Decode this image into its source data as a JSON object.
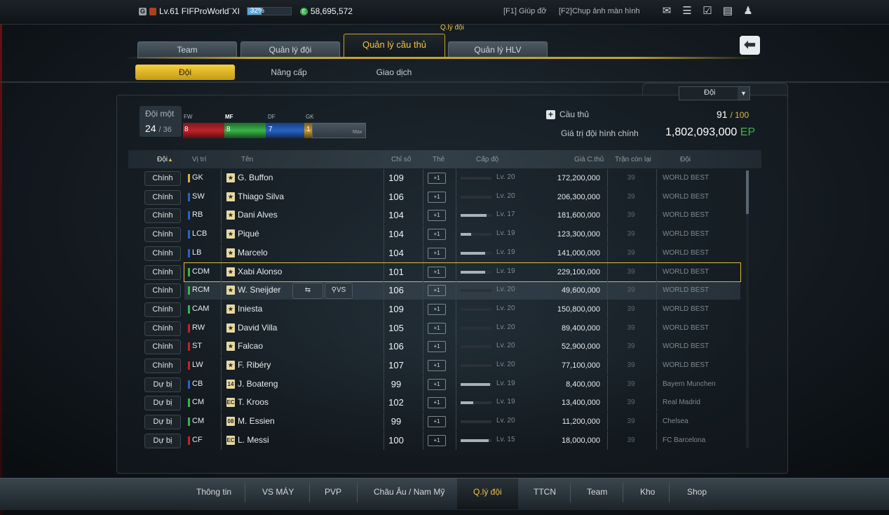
{
  "topbar": {
    "guild_badge": "G",
    "level_text": "Lv.61 FIFProWorld¨XI",
    "exp_percent": 32,
    "exp_label": "32%",
    "coins": "58,695,572",
    "help": "[F1] Giúp đỡ",
    "screenshot": "[F2]Chụp ảnh màn hình",
    "icons": [
      "mail-icon",
      "list-icon",
      "calendar-check-icon",
      "chat-icon",
      "user-icon"
    ]
  },
  "page_hint": "Q.lý đội",
  "main_tabs": [
    {
      "label": "Team"
    },
    {
      "label": "Quản lý đội"
    },
    {
      "label": "Quản lý cầu thủ",
      "active": true
    },
    {
      "label": "Quản lý HLV"
    }
  ],
  "sub_tabs": [
    {
      "label": "Đội",
      "active": true
    },
    {
      "label": "Nâng cấp"
    },
    {
      "label": "Giao dịch"
    }
  ],
  "filter": {
    "selected": "Đội"
  },
  "team_summary": {
    "title": "Đội một",
    "current": "24",
    "max": "/ 36",
    "positions": [
      {
        "label": "FW",
        "count": "8",
        "color": "#c2222a"
      },
      {
        "label": "MF",
        "count": "8",
        "color": "#3cb34a"
      },
      {
        "label": "DF",
        "count": "7",
        "color": "#2a63c4"
      },
      {
        "label": "GK",
        "count": "1",
        "color": "#c99a2c"
      }
    ],
    "max_label": "Max"
  },
  "players_info": {
    "label": "Cầu thủ",
    "count": "91",
    "limit": "/ 100",
    "value_label": "Giá trị đội hình chính",
    "value": "1,802,093,000",
    "value_unit": "EP"
  },
  "table": {
    "headers": {
      "team_status": "Đội",
      "position": "Vị trí",
      "name": "Tên",
      "ovr": "Chỉ số",
      "card": "Thẻ",
      "level": "Cấp độ",
      "price": "Giá C.thủ",
      "games": "Trận còn lại",
      "club": "Đội"
    },
    "rows": [
      {
        "status": "Chính",
        "pos": "GK",
        "pos_color": "#d9b23a",
        "card": "★",
        "name": "G. Buffon",
        "ovr": "109",
        "lvl": "Lv. 20",
        "lvl_frac": 0.0,
        "price": "172,200,000",
        "games": "39",
        "club": "WORLD BEST"
      },
      {
        "status": "Chính",
        "pos": "SW",
        "pos_color": "#2a63c4",
        "card": "★",
        "name": "Thiago Silva",
        "ovr": "106",
        "lvl": "Lv. 20",
        "lvl_frac": 0.0,
        "price": "206,300,000",
        "games": "39",
        "club": "WORLD BEST"
      },
      {
        "status": "Chính",
        "pos": "RB",
        "pos_color": "#2a63c4",
        "card": "★",
        "name": "Dani Alves",
        "ovr": "104",
        "lvl": "Lv. 17",
        "lvl_frac": 0.85,
        "price": "181,600,000",
        "games": "39",
        "club": "WORLD BEST"
      },
      {
        "status": "Chính",
        "pos": "LCB",
        "pos_color": "#2a63c4",
        "card": "★",
        "name": "Piqué",
        "ovr": "104",
        "lvl": "Lv. 19",
        "lvl_frac": 0.35,
        "price": "123,300,000",
        "games": "39",
        "club": "WORLD BEST"
      },
      {
        "status": "Chính",
        "pos": "LB",
        "pos_color": "#2a63c4",
        "card": "★",
        "name": "Marcelo",
        "ovr": "104",
        "lvl": "Lv. 19",
        "lvl_frac": 0.8,
        "price": "141,000,000",
        "games": "39",
        "club": "WORLD BEST"
      },
      {
        "status": "Chính",
        "pos": "CDM",
        "pos_color": "#3cb34a",
        "card": "★",
        "name": "Xabi Alonso",
        "ovr": "101",
        "lvl": "Lv. 19",
        "lvl_frac": 0.8,
        "price": "229,100,000",
        "games": "39",
        "club": "WORLD BEST",
        "selected": true
      },
      {
        "status": "Chính",
        "pos": "RCM",
        "pos_color": "#3cb34a",
        "card": "★",
        "name": "W. Sneijder",
        "ovr": "106",
        "lvl": "Lv. 20",
        "lvl_frac": 0.0,
        "price": "49,600,000",
        "games": "39",
        "club": "WORLD BEST",
        "hover": true
      },
      {
        "status": "Chính",
        "pos": "CAM",
        "pos_color": "#3cb34a",
        "card": "★",
        "name": "Iniesta",
        "ovr": "109",
        "lvl": "Lv. 20",
        "lvl_frac": 0.0,
        "price": "150,800,000",
        "games": "39",
        "club": "WORLD BEST"
      },
      {
        "status": "Chính",
        "pos": "RW",
        "pos_color": "#c2222a",
        "card": "★",
        "name": "David Villa",
        "ovr": "105",
        "lvl": "Lv. 20",
        "lvl_frac": 0.0,
        "price": "89,400,000",
        "games": "39",
        "club": "WORLD BEST"
      },
      {
        "status": "Chính",
        "pos": "ST",
        "pos_color": "#c2222a",
        "card": "★",
        "name": "Falcao",
        "ovr": "106",
        "lvl": "Lv. 20",
        "lvl_frac": 0.0,
        "price": "52,900,000",
        "games": "39",
        "club": "WORLD BEST"
      },
      {
        "status": "Chính",
        "pos": "LW",
        "pos_color": "#c2222a",
        "card": "★",
        "name": "F. Ribéry",
        "ovr": "107",
        "lvl": "Lv. 20",
        "lvl_frac": 0.0,
        "price": "77,100,000",
        "games": "39",
        "club": "WORLD BEST"
      },
      {
        "status": "Dự bị",
        "pos": "CB",
        "pos_color": "#2a63c4",
        "card": "14",
        "name": "J. Boateng",
        "ovr": "99",
        "lvl": "Lv. 19",
        "lvl_frac": 0.95,
        "price": "8,400,000",
        "games": "39",
        "club": "Bayern Munchen"
      },
      {
        "status": "Dự bị",
        "pos": "CM",
        "pos_color": "#3cb34a",
        "card": "EC",
        "name": "T. Kroos",
        "ovr": "102",
        "lvl": "Lv. 19",
        "lvl_frac": 0.4,
        "price": "13,400,000",
        "games": "39",
        "club": "Real Madrid"
      },
      {
        "status": "Dự bị",
        "pos": "CM",
        "pos_color": "#3cb34a",
        "card": "08",
        "name": "M. Essien",
        "ovr": "99",
        "lvl": "Lv. 20",
        "lvl_frac": 0.0,
        "price": "11,200,000",
        "games": "39",
        "club": "Chelsea"
      },
      {
        "status": "Dự bị",
        "pos": "CF",
        "pos_color": "#c2222a",
        "card": "EC",
        "name": "L. Messi",
        "ovr": "100",
        "lvl": "Lv. 15",
        "lvl_frac": 0.9,
        "price": "18,000,000",
        "games": "39",
        "club": "FC Barcelona"
      }
    ],
    "hover_actions": {
      "compare": "VS"
    }
  },
  "bottom_nav": [
    {
      "label": "Thông tin"
    },
    {
      "label": "VS MÁY"
    },
    {
      "label": "PVP"
    },
    {
      "label": "Châu Âu / Nam Mỹ"
    },
    {
      "label": "Q.lý đội",
      "active": true
    },
    {
      "label": "TTCN"
    },
    {
      "label": "Team"
    },
    {
      "label": "Kho"
    },
    {
      "label": "Shop"
    }
  ]
}
